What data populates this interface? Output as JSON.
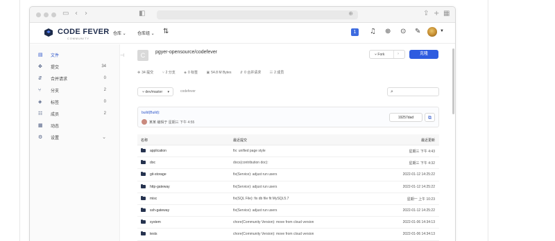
{
  "header": {
    "logo_text": "CODE FEVER",
    "logo_sub": "COMMUNITY",
    "nav_repo": "仓库",
    "nav_repo_group": "仓库组",
    "badge": "1"
  },
  "sidebar": {
    "items": [
      {
        "label": "文件",
        "count": "",
        "icon": "file-icon"
      },
      {
        "label": "提交",
        "count": "34",
        "icon": "commit-icon"
      },
      {
        "label": "合并请求",
        "count": "0",
        "icon": "merge-request-icon"
      },
      {
        "label": "分支",
        "count": "2",
        "icon": "branch-icon"
      },
      {
        "label": "标签",
        "count": "0",
        "icon": "tag-icon"
      },
      {
        "label": "成员",
        "count": "2",
        "icon": "members-icon"
      },
      {
        "label": "动态",
        "count": "",
        "icon": "activity-icon"
      },
      {
        "label": "设置",
        "count": "",
        "icon": "settings-icon"
      }
    ]
  },
  "repo": {
    "avatar_letter": "C",
    "name": "pgyer-opensource/codefever",
    "fork_label": "Fork",
    "clone_label": "克隆",
    "stats": [
      "34 提交",
      "2 分支",
      "0 标签",
      "54.8 M Bytes",
      "0 合并请求",
      "2 成员"
    ],
    "branch": "dev/master",
    "path": "codefever"
  },
  "commit": {
    "message": "build(Build):",
    "meta": "某某  编辑于 星期三 下午 4:55",
    "sha": "19257dad"
  },
  "table": {
    "headers": {
      "name": "名称",
      "commit": "最近提交",
      "updated": "最近更新"
    },
    "rows": [
      {
        "name": "application",
        "commit": "fix: unified page style",
        "updated": "星期三 下午 4:43"
      },
      {
        "name": "doc",
        "commit": "docs(contribution doc):",
        "updated": "星期三 下午 4:32"
      },
      {
        "name": "git-storage",
        "commit": "fix(Service): adjust run users",
        "updated": "2022-01-12 14:25:22"
      },
      {
        "name": "http-gateway",
        "commit": "fix(Service): adjust run users",
        "updated": "2022-01-12 14:25:22"
      },
      {
        "name": "misc",
        "commit": "fix(SQL File): fix db file fit MySQL5.7",
        "updated": "星期一 上午 10:23"
      },
      {
        "name": "ssh-gateway",
        "commit": "fix(Service): adjust run users",
        "updated": "2022-01-12 14:25:22"
      },
      {
        "name": "system",
        "commit": "chore(Community Version): move from cloud version",
        "updated": "2022-01-06 14:34:13"
      },
      {
        "name": "tests",
        "commit": "chore(Community Version): move from cloud version",
        "updated": "2022-01-06 14:34:13"
      }
    ]
  }
}
